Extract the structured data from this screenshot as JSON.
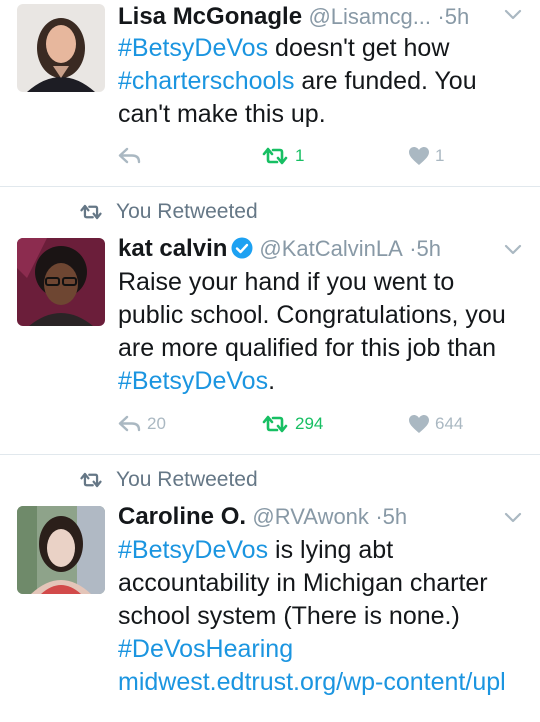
{
  "tweets": [
    {
      "retweet_context": "",
      "name": "Lisa McGonagle",
      "verified": false,
      "handle": "@Lisamcg...",
      "time": "5h",
      "body": [
        {
          "t": "#BetsyDeVos",
          "k": "tag"
        },
        {
          "t": " doesn't get how ",
          "k": "text"
        },
        {
          "t": "#charterschools",
          "k": "tag"
        },
        {
          "t": " are funded. You can't make this up.",
          "k": "text"
        }
      ],
      "reply_count": "",
      "retweet_count": "1",
      "like_count": "1",
      "retweeted": true
    },
    {
      "retweet_context": "You Retweeted",
      "name": "kat calvin",
      "verified": true,
      "handle": "@KatCalvinLA",
      "time": "5h",
      "body": [
        {
          "t": "Raise your hand if you went to public school. Congratulations, you are more qualified for this job than ",
          "k": "text"
        },
        {
          "t": "#BetsyDeVos",
          "k": "tag"
        },
        {
          "t": ".",
          "k": "text"
        }
      ],
      "reply_count": "20",
      "retweet_count": "294",
      "like_count": "644",
      "retweeted": true
    },
    {
      "retweet_context": "You Retweeted",
      "name": "Caroline O.",
      "verified": false,
      "handle": "@RVAwonk",
      "time": "5h",
      "body": [
        {
          "t": "#BetsyDeVos",
          "k": "tag"
        },
        {
          "t": " is lying abt accountability in Michigan charter school system (There is none.) ",
          "k": "text"
        },
        {
          "t": "#DeVosHearing",
          "k": "tag"
        },
        {
          "t": " ",
          "k": "text"
        },
        {
          "t": "midwest.edtrust.org/wp-content/upl",
          "k": "link"
        }
      ],
      "reply_count": "",
      "retweet_count": "",
      "like_count": "",
      "retweeted": false
    }
  ],
  "colors": {
    "link": "#1b95e0",
    "retweet_active": "#17bf63",
    "muted": "#8899a6",
    "icon_inactive": "#aab8c2",
    "divider": "#e1e8ed"
  }
}
